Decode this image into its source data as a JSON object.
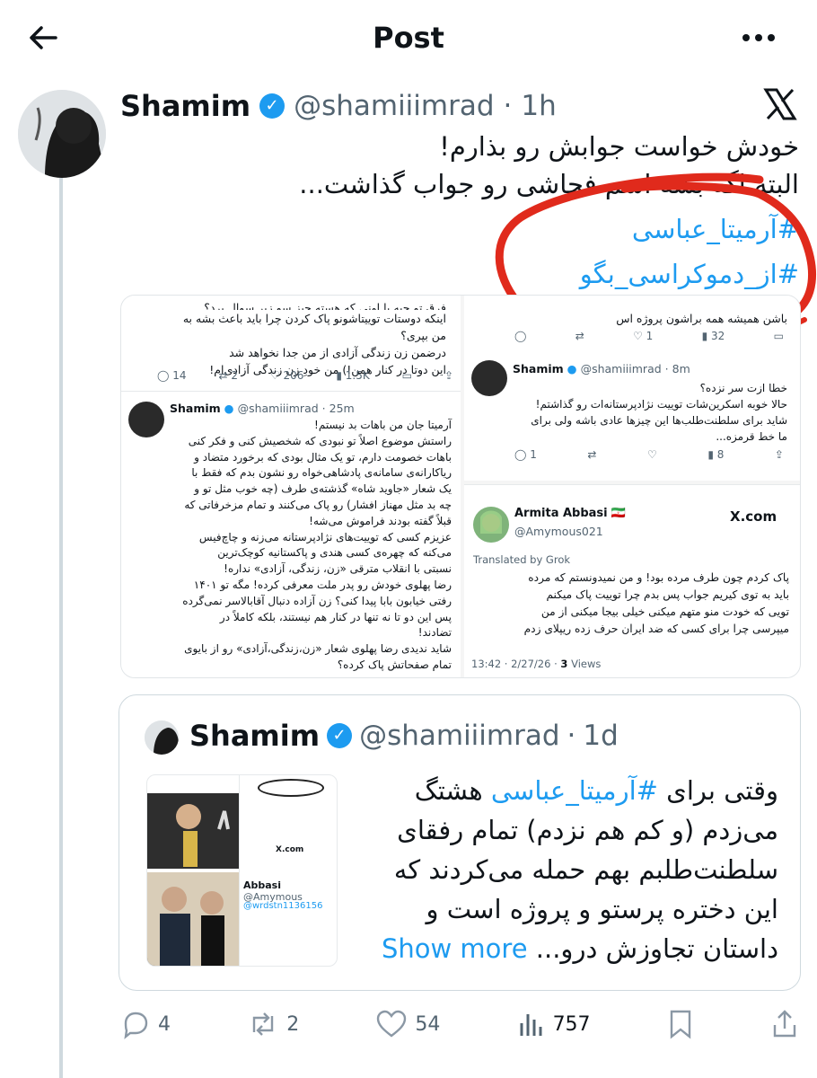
{
  "header": {
    "back_icon": "arrow-left-icon",
    "title": "Post",
    "more_icon": "more-dots-icon"
  },
  "post": {
    "author_name": "Shamim",
    "handle": "@shamiiimrad",
    "time": "1h",
    "text_line1": "خودش خواست جوابش رو بذارم!",
    "text_line2": "البته اگه بشه اسم فحاشی رو جواب گذاشت...",
    "hashtag1": "#آرمیتا_عباسی",
    "hashtag2": "#از_دموکراسی_بگو",
    "annotation_color": "#e02a1c"
  },
  "screenshot_left": {
    "top_text": [
      "فرق تو چیه با اونی که هسته چیز سو زیر سوال برد؟",
      "اینکه دوستات توییتاشونو پاک کردن چرا باید باعث بشه به",
      "من بپری؟",
      "درضمن زن زندگی آزادی از من جدا نخواهد شد",
      "این دوتا در کنار همن!) من خودِ زن زندگی آزادی‌ام!"
    ],
    "top_actions": {
      "replies": "14",
      "reposts": "2",
      "likes": "206",
      "views": "1.5K"
    },
    "name": "Shamim",
    "handle": "@shamiiimrad",
    "time": "25m",
    "body": [
      "آرمیتا جان من باهات بد نیستم!",
      "راستش موضوع اصلاً تو نبودی که شخصیش کنی و فکر کنی",
      "باهات خصومت دارم، تو یک مثال بودی که برخورد متضاد و",
      "ریاکارانه‌ی سامانه‌ی پادشاهی‌خواه رو نشون بدم که فقط با",
      "یک شعار «جاوید شاه» گذشته‌ی طرف (چه خوب مثل تو و",
      "چه بد مثل مهناز افشار) رو پاک می‌کنند و تمام مزخرفاتی که",
      "قبلاً گفته بودند فراموش می‌شه!",
      "عزیزم کسی که توییت‌های نژادپرستانه می‌زنه و چاچ‌فیس",
      "می‌کنه که چهره‌ی کسی هندی و پاکستانیه کوچک‌ترین",
      "نسبتی با انقلاب مترقی «زن، زندگی، آزادی» نداره!",
      "رضا پهلوی خودش رو پدر ملت معرفی کرده! مگه تو ۱۴۰۱",
      "رفتی خیابون بابا پیدا کنی؟ زن آزاده دنبال آقابالاسر نمی‌گرده",
      "پس این دو تا نه تنها در کنار هم نیستند، بلکه کاملاً در",
      "تضادند!",
      "شاید ندیدی رضا پهلوی شعار «زن،زندگی،آزادی» رو از بایوی",
      "تمام صفحاتش پاک کرده؟"
    ]
  },
  "screenshot_right": {
    "top_text": "باشن همیشه همه براشون پروژه اس",
    "top_actions": {
      "replies": "",
      "reposts": "",
      "likes": "1",
      "views": "32"
    },
    "name": "Shamim",
    "handle": "@shamiiimrad",
    "time": "8m",
    "body": [
      "خطا ازت سر نزده؟",
      "حالا خوبه اسکرین‌شات توییت نژادپرستانه‌ات رو گذاشتم!",
      "شاید برای سلطنت‌طلب‌ها این چیزها عادی باشه ولی برای",
      "ما خط قرمزه..."
    ],
    "actions": {
      "replies": "1",
      "views": "8"
    }
  },
  "armita_card": {
    "name": "Armita Abbasi",
    "flag": "🇮🇷",
    "handle": "@Amymous021",
    "source": "X.com",
    "translated": "Translated by Grok",
    "body": [
      "پاک کردم چون طرف مرده بود! و من نمیدونستم که مرده",
      "باید به توی کیریم جواب پس بدم چرا توییت پاک میکنم",
      "تویی که خودت منو متهم میکنی خیلی بیجا میکنی از من",
      "میپرسی چرا برای کسی که ضد ایران حرف زده ریپلای زدم"
    ],
    "timestamp": "13:42 · 2/27/26 ·",
    "views_count": "3",
    "views_label": "Views"
  },
  "quote": {
    "author_name": "Shamim",
    "handle": "@shamiiimrad",
    "time": "1d",
    "text_prefix": "وقتی برای",
    "hashtag": "#آرمیتا_عباسی",
    "text_suffix": "هشتگ",
    "lines": [
      "می‌زدم (و کم هم نزدم) تمام رفقای",
      "سلطنت‌طلبم بهم حمله می‌کردند که",
      "این دختره پرستو و پروژه است و"
    ],
    "last_line": "داستان تجاوزش درو...",
    "show_more": "Show more",
    "thumb_left_text": "X.com",
    "thumb_right_name": "Abbasi",
    "thumb_right_handle": "@Amymous",
    "thumb_right_link": "@wrdstn1136156"
  },
  "actions": {
    "replies": "4",
    "reposts": "2",
    "likes": "54",
    "views": "757"
  }
}
